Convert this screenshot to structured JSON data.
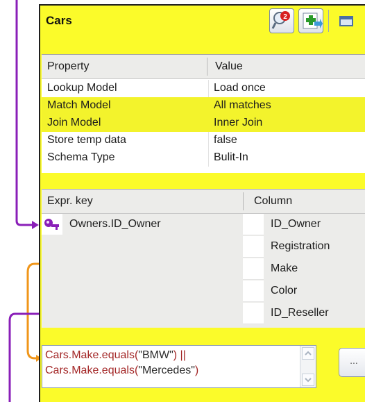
{
  "table_name": "Cars",
  "property_table": {
    "headers": {
      "property": "Property",
      "value": "Value"
    },
    "rows": [
      {
        "key": "Lookup Model",
        "value": "Load once",
        "highlighted": false
      },
      {
        "key": "Match Model",
        "value": "All matches",
        "highlighted": true
      },
      {
        "key": "Join Model",
        "value": "Inner Join",
        "highlighted": true
      },
      {
        "key": "Store temp data",
        "value": "false",
        "highlighted": false
      },
      {
        "key": "Schema Type",
        "value": "Bulit-In",
        "highlighted": false
      }
    ]
  },
  "expr_table": {
    "headers": {
      "expr_key": "Expr. key",
      "column": "Column"
    },
    "key_row": {
      "icon": "key-icon",
      "expression": "Owners.ID_Owner"
    },
    "columns": [
      "ID_Owner",
      "Registration",
      "Make",
      "Color",
      "ID_Reseller"
    ]
  },
  "filter": {
    "line1": {
      "call": "Cars.Make.equals(",
      "arg": "\"BMW\"",
      "close": ")",
      "op": "||"
    },
    "line2": {
      "call": "Cars.Make.equals(",
      "arg": "\"Mercedes\"",
      "close": ")"
    }
  },
  "buttons": {
    "filter_editor": "...",
    "toolbar_icons": [
      "magnifier-badge-icon",
      "add-green-icon",
      "panel-icon"
    ]
  },
  "colors": {
    "panel_bg": "#fbfb2a",
    "connector_purple": "#8a1fb8",
    "connector_orange": "#f0961a",
    "filter_text": "#a32626"
  }
}
